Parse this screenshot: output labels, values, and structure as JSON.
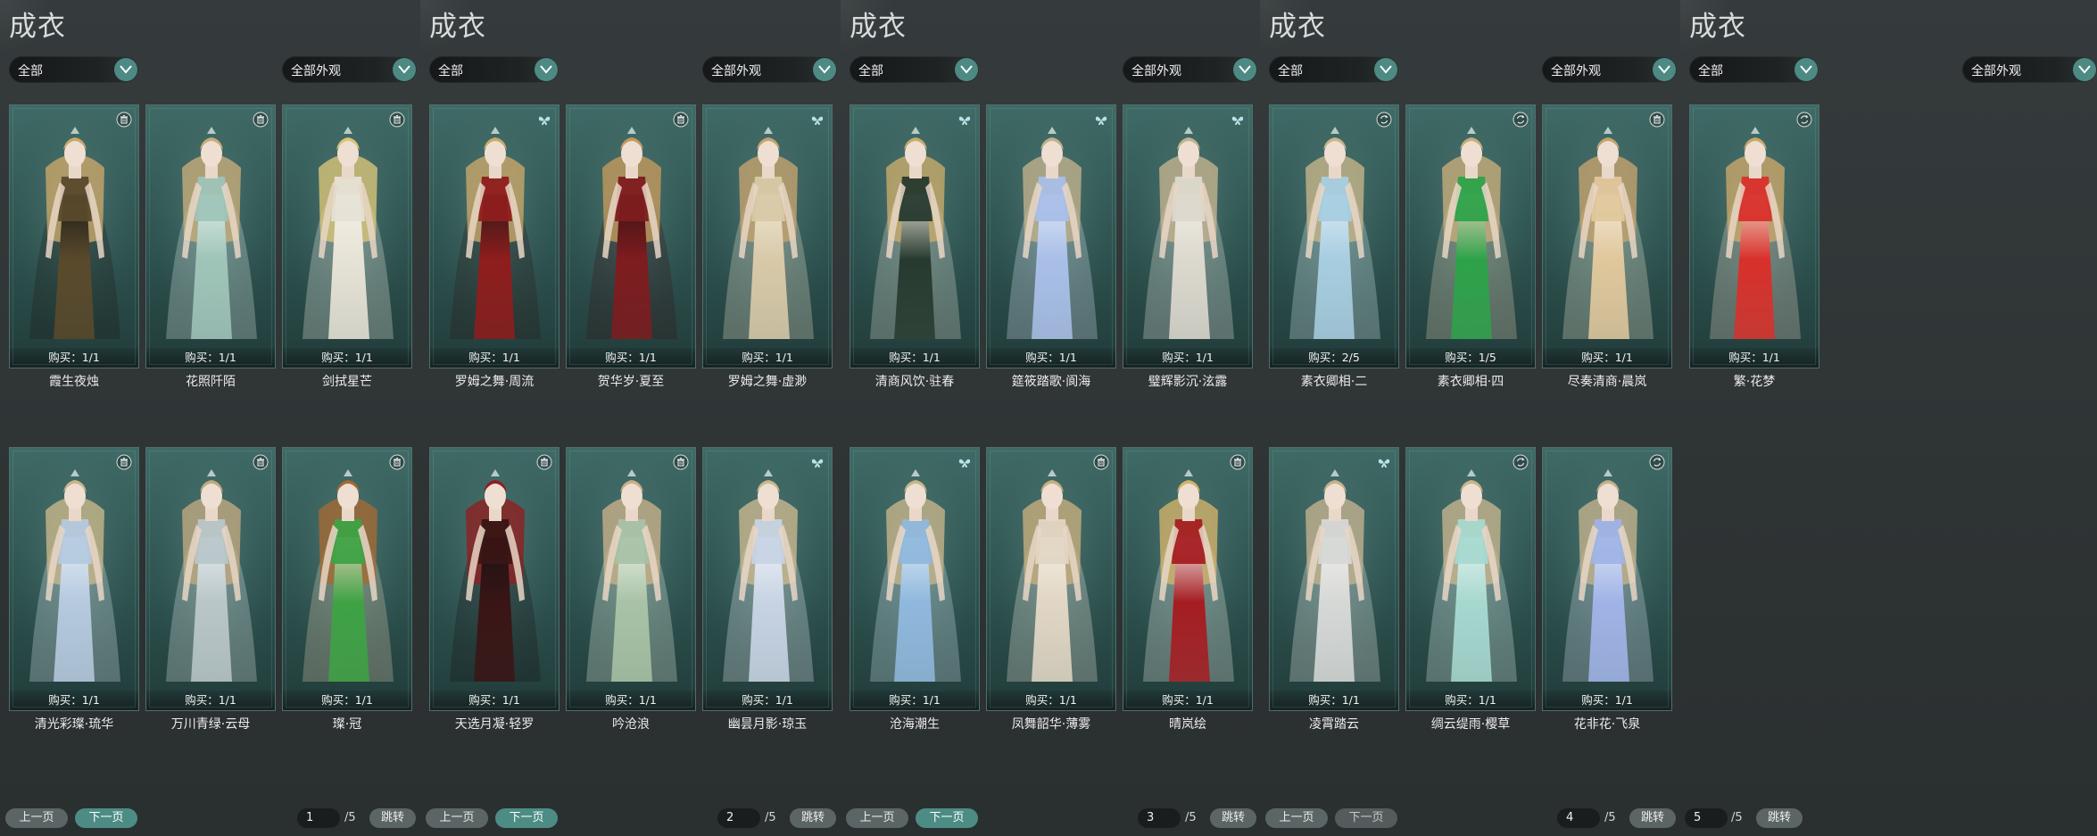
{
  "common": {
    "title": "成衣",
    "filter_all": "全部",
    "filter_look": "全部外观",
    "prev": "上一页",
    "next": "下一页",
    "jump": "跳转",
    "total": "/5"
  },
  "colors": {
    "accent": "#4d8a83",
    "card": "#2d524f"
  },
  "panels": [
    {
      "page": "1",
      "cards": [
        {
          "name": "霞生夜烛",
          "buy": "购买：1/1",
          "icon": "trash-icon",
          "pal": [
            "#5a4a2c",
            "#1b1a16",
            "#c9a86a"
          ]
        },
        {
          "name": "花照阡陌",
          "buy": "购买：1/1",
          "icon": "trash-icon",
          "pal": [
            "#9fc4b8",
            "#dfeee8",
            "#c7ad7a"
          ]
        },
        {
          "name": "剑拭星芒",
          "buy": "购买：1/1",
          "icon": "trash-icon",
          "pal": [
            "#e6e2d6",
            "#f5f1e5",
            "#d8c478"
          ]
        },
        {
          "name": "清光彩璨·琉华",
          "buy": "购买：1/1",
          "icon": "trash-icon",
          "pal": [
            "#b5c9df",
            "#e2ecf5",
            "#c8b78a"
          ]
        },
        {
          "name": "万川青绿·云母",
          "buy": "购买：1/1",
          "icon": "trash-icon",
          "pal": [
            "#b9c6c9",
            "#e6eced",
            "#bfa981"
          ]
        },
        {
          "name": "璨·冠",
          "buy": "购买：1/1",
          "icon": "trash-icon",
          "pal": [
            "#3ea245",
            "#e7d0b4",
            "#a26a35"
          ]
        }
      ]
    },
    {
      "page": "2",
      "cards": [
        {
          "name": "罗姆之舞·周流",
          "buy": "购买：1/1",
          "icon": "butterfly-icon",
          "pal": [
            "#8f1d1d",
            "#2a1a18",
            "#c9a86a"
          ]
        },
        {
          "name": "贺华岁·夏至",
          "buy": "购买：1/1",
          "icon": "trash-icon",
          "pal": [
            "#7e1c1f",
            "#3a1314",
            "#c49a5e"
          ]
        },
        {
          "name": "罗姆之舞·虚渺",
          "buy": "购买：1/1",
          "icon": "butterfly-icon",
          "pal": [
            "#d8c9a8",
            "#efe6d2",
            "#c4a36e"
          ]
        },
        {
          "name": "天选月凝·轻罗",
          "buy": "购买：1/1",
          "icon": "trash-icon",
          "pal": [
            "#3a1515",
            "#1a1214",
            "#8d2020"
          ]
        },
        {
          "name": "吟沧浪",
          "buy": "购买：1/1",
          "icon": "trash-icon",
          "pal": [
            "#a8c2a6",
            "#e9efe4",
            "#c7b08a"
          ]
        },
        {
          "name": "幽昙月影·琼玉",
          "buy": "购买：1/1",
          "icon": "butterfly-icon",
          "pal": [
            "#c7d3e3",
            "#eef2f7",
            "#c9b88f"
          ]
        }
      ]
    },
    {
      "page": "3",
      "cards": [
        {
          "name": "清商风饮·驻春",
          "buy": "购买：1/1",
          "icon": "butterfly-icon",
          "pal": [
            "#273a2f",
            "#e9e4d6",
            "#c8ab6c"
          ]
        },
        {
          "name": "筵筱踏歌·阆海",
          "buy": "购买：1/1",
          "icon": "butterfly-icon",
          "pal": [
            "#a9bfe8",
            "#dde6f7",
            "#c0b08c"
          ]
        },
        {
          "name": "璧辉影沉·泫露",
          "buy": "购买：1/1",
          "icon": "butterfly-icon",
          "pal": [
            "#dcd8ce",
            "#f1eee6",
            "#c4b38f"
          ]
        },
        {
          "name": "沧海潮生",
          "buy": "购买：1/1",
          "icon": "butterfly-icon",
          "pal": [
            "#8fb8dc",
            "#d8e8f5",
            "#c6b48b"
          ]
        },
        {
          "name": "凤舞韶华·薄雾",
          "buy": "购买：1/1",
          "icon": "trash-icon",
          "pal": [
            "#e1d6c4",
            "#f3ede2",
            "#c7ae7e"
          ]
        },
        {
          "name": "晴岚绘",
          "buy": "购买：1/1",
          "icon": "trash-icon",
          "pal": [
            "#a51d22",
            "#f2efe9",
            "#d2b36a"
          ]
        }
      ]
    },
    {
      "page": "4",
      "cards": [
        {
          "name": "素衣卿相·二",
          "buy": "购买：2/5",
          "icon": "swap-icon",
          "pal": [
            "#a7cde0",
            "#dcecf4",
            "#c6b48a"
          ]
        },
        {
          "name": "素衣卿相·四",
          "buy": "购买：1/5",
          "icon": "swap-icon",
          "pal": [
            "#2ea24a",
            "#e9d3b8",
            "#c7ad7a"
          ]
        },
        {
          "name": "尽奏清商·晨岚",
          "buy": "购买：1/1",
          "icon": "trash-icon",
          "pal": [
            "#e0c79c",
            "#f2e8d5",
            "#c4a36e"
          ]
        },
        {
          "name": "凌霄踏云",
          "buy": "购买：1/1",
          "icon": "butterfly-icon",
          "pal": [
            "#d6d8d6",
            "#f0f0ec",
            "#c2b28e"
          ]
        },
        {
          "name": "绸云缇雨·樱草",
          "buy": "购买：1/1",
          "icon": "swap-icon",
          "pal": [
            "#a6d8cf",
            "#e2f3ef",
            "#c5b48e"
          ]
        },
        {
          "name": "花非花·飞泉",
          "buy": "购买：1/1",
          "icon": "swap-icon",
          "pal": [
            "#9fb3e6",
            "#dce3f6",
            "#c2b18c"
          ]
        }
      ]
    },
    {
      "page": "5",
      "cards": [
        {
          "name": "繁·花梦",
          "buy": "购买：1/1",
          "icon": "swap-icon",
          "pal": [
            "#d8302a",
            "#f0d7c8",
            "#c9a86a"
          ]
        }
      ]
    }
  ]
}
